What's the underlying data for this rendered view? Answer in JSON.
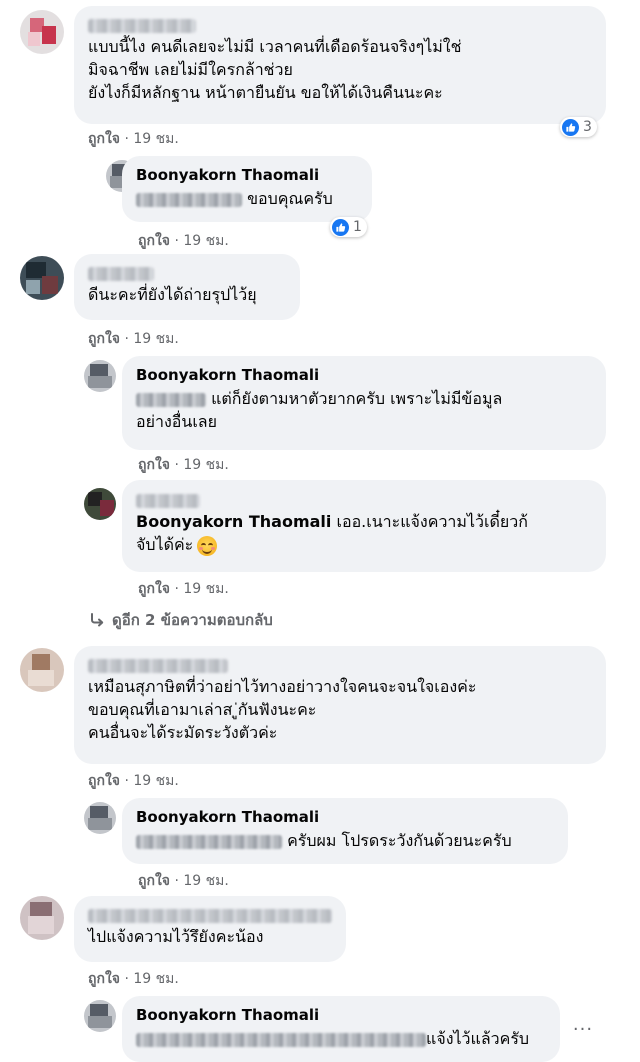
{
  "comments": [
    {
      "text_lines": [
        "แบบนี้ไง คนดีเลยจะไม่มี เวลาคนที่เดือดร้อนจริงๆไม่ใช่",
        "มิจฉาชีพ เลยไม่มีใครกล้าช่วย",
        "ยังไงก็มีหลักฐาน หน้าตายืนยัน ขอให้ได้เงินคืนนะคะ"
      ],
      "like_label": "ถูกใจ",
      "time": "19 ชม.",
      "reaction_count": "3"
    },
    {
      "author": "Boonyakorn Thaomali",
      "text": "ขอบคุณครับ",
      "like_label": "ถูกใจ",
      "time": "19 ชม.",
      "reaction_count": "1"
    },
    {
      "text_lines": [
        "ดีนะคะที่ยังได้ถ่ายรุปไว้ยุ"
      ],
      "like_label": "ถูกใจ",
      "time": "19 ชม."
    },
    {
      "author": "Boonyakorn Thaomali",
      "text_lines": [
        "แต่ก็ยังตามหาตัวยากครับ เพราะไม่มีข้อมูล",
        "อย่างอื่นเลย"
      ],
      "like_label": "ถูกใจ",
      "time": "19 ชม."
    },
    {
      "mention": "Boonyakorn Thaomali",
      "text_lines": [
        "เออ.เนาะแจ้งความไว้เดี๋ยวก้",
        "จับได้ค่ะ"
      ],
      "emoji": "smiling-face-emoji",
      "like_label": "ถูกใจ",
      "time": "19 ชม."
    },
    {
      "text_lines": [
        "เหมือนสุภาษิตที่ว่าอย่าไว้ทางอย่าวางใจคนจะจนใจเองค่ะ",
        "ขอบคุณที่เอามาเล่าส ู่กันฟังนะคะ",
        "คนอื่นจะได้ระมัดระวังตัวค่ะ"
      ],
      "like_label": "ถูกใจ",
      "time": "19 ชม."
    },
    {
      "author": "Boonyakorn Thaomali",
      "text": "ครับผม โปรดระวังกันด้วยนะครับ",
      "like_label": "ถูกใจ",
      "time": "19 ชม."
    },
    {
      "text_lines": [
        "ไปแจ้งความไว้รึยังคะน้อง"
      ],
      "like_label": "ถูกใจ",
      "time": "19 ชม."
    },
    {
      "author": "Boonyakorn Thaomali",
      "text": "แจ้งไว้แล้วครับ"
    }
  ],
  "more_replies": "ดูอีก 2 ข้อความตอบกลับ",
  "more_options": "···",
  "colors": {
    "like_blue": "#1877f2",
    "bubble": "#f0f2f5",
    "meta": "#65676b"
  }
}
